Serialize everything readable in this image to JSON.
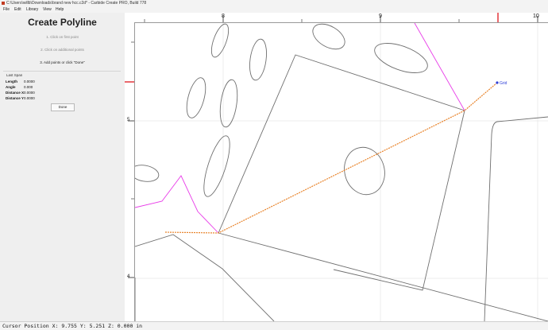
{
  "window": {
    "title": "C:\\Users\\willb\\Downloads\\brand new hcc.c2d* - Carbide Create PRO, Build 778"
  },
  "menu": [
    "File",
    "Edit",
    "Library",
    "View",
    "Help"
  ],
  "panel": {
    "heading": "Create Polyline",
    "steps": [
      "1. Click on first point",
      "2. Click on additional points",
      "3. Add points or click \"Done\""
    ],
    "last_span_label": "Last Span",
    "rows": [
      {
        "label": "Length",
        "value": "0.0000"
      },
      {
        "label": "Angle",
        "value": "0.000"
      },
      {
        "label": "Distance X",
        "value": "0.0000"
      },
      {
        "label": "Distance Y",
        "value": "0.0000"
      }
    ],
    "done_label": "Done"
  },
  "ruler": {
    "top_labels": [
      "8",
      "9",
      "10"
    ],
    "left_labels": [
      "5",
      "4"
    ]
  },
  "canvas": {
    "grid_label": "Grid",
    "colors": {
      "geometry": "#6f6f6f",
      "draft": "#e8832a",
      "magenta": "#e83be8",
      "grid": "#2f3fd8",
      "marker": "#e0282c"
    }
  },
  "status": {
    "cursor_position": "Cursor Position X: 9.755 Y: 5.251 Z: 0.000 in"
  }
}
